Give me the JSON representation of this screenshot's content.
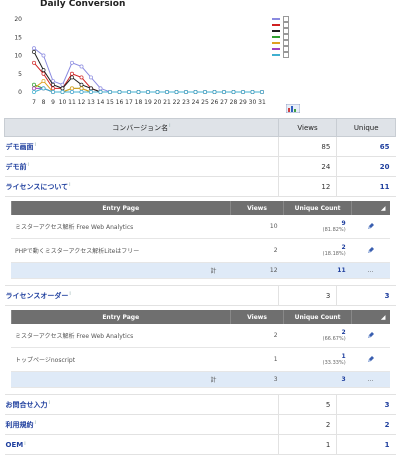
{
  "chart": {
    "title": "Daily Conversion",
    "export_icon": "chart-export-icon"
  },
  "chart_data": {
    "type": "line",
    "title": "Daily Conversion",
    "x": [
      7,
      8,
      9,
      10,
      11,
      12,
      13,
      14,
      15,
      16,
      17,
      18,
      19,
      20,
      21,
      22,
      23,
      24,
      25,
      26,
      27,
      28,
      29,
      30,
      31
    ],
    "ylim": [
      0,
      20
    ],
    "yticks": [
      0,
      5,
      10,
      15,
      20
    ],
    "grid": false,
    "legend_placement": "right",
    "series": [
      {
        "color": "#8a8ae0",
        "values": [
          12,
          10,
          3,
          2,
          8,
          7,
          4,
          1,
          0,
          0,
          0,
          0,
          0,
          0,
          0,
          0,
          0,
          0,
          0,
          0,
          0,
          0,
          0,
          0,
          0
        ]
      },
      {
        "color": "#d02020",
        "values": [
          8,
          5,
          1,
          1,
          5,
          4,
          1,
          0,
          0,
          0,
          0,
          0,
          0,
          0,
          0,
          0,
          0,
          0,
          0,
          0,
          0,
          0,
          0,
          0,
          0
        ]
      },
      {
        "color": "#202020",
        "values": [
          11,
          6,
          2,
          1,
          4,
          2,
          1,
          0,
          0,
          0,
          0,
          0,
          0,
          0,
          0,
          0,
          0,
          0,
          0,
          0,
          0,
          0,
          0,
          0,
          0
        ]
      },
      {
        "color": "#30a030",
        "values": [
          2,
          1,
          0,
          0,
          1,
          1,
          0,
          0,
          0,
          0,
          0,
          0,
          0,
          0,
          0,
          0,
          0,
          0,
          0,
          0,
          0,
          0,
          0,
          0,
          0
        ]
      },
      {
        "color": "#e0a020",
        "values": [
          1,
          3,
          0,
          0,
          1,
          1,
          0,
          0,
          0,
          0,
          0,
          0,
          0,
          0,
          0,
          0,
          0,
          0,
          0,
          0,
          0,
          0,
          0,
          0,
          0
        ]
      },
      {
        "color": "#a040c0",
        "values": [
          1,
          1,
          0,
          0,
          0,
          0,
          0,
          0,
          0,
          0,
          0,
          0,
          0,
          0,
          0,
          0,
          0,
          0,
          0,
          0,
          0,
          0,
          0,
          0,
          0
        ]
      },
      {
        "color": "#40b0d0",
        "values": [
          0,
          1,
          0,
          0,
          0,
          0,
          0,
          0,
          0,
          0,
          0,
          0,
          0,
          0,
          0,
          0,
          0,
          0,
          0,
          0,
          0,
          0,
          0,
          0,
          0
        ]
      }
    ]
  },
  "report": {
    "headers": {
      "name": "コンバージョン名",
      "views": "Views",
      "unique": "Unique"
    },
    "rows": [
      {
        "name": "デモ画面",
        "views": "85",
        "unique": "65"
      },
      {
        "name": "デモ前",
        "views": "24",
        "unique": "20"
      },
      {
        "name": "ライセンスについて",
        "views": "12",
        "unique": "11"
      },
      {
        "name": "ライセンスオーダー",
        "views": "3",
        "unique": "3"
      },
      {
        "name": "お問合せ入力",
        "views": "5",
        "unique": "3"
      },
      {
        "name": "利用規約",
        "views": "2",
        "unique": "2"
      },
      {
        "name": "OEM",
        "views": "1",
        "unique": "1"
      }
    ],
    "sub_headers": {
      "page": "Entry Page",
      "views": "Views",
      "unique": "Unique Count"
    },
    "sub1": {
      "rows": [
        {
          "page": "ミスターアクセス解析 Free Web Analytics",
          "views": "10",
          "unique": "9",
          "pct": "(81.82%)"
        },
        {
          "page": "PHPで動くミスターアクセス解析Liteはフリー",
          "views": "2",
          "unique": "2",
          "pct": "(18.18%)"
        }
      ],
      "total_label": "計",
      "total_views": "12",
      "total_unique": "11",
      "total_extra": "..."
    },
    "sub2": {
      "rows": [
        {
          "page": "ミスターアクセス解析 Free Web Analytics",
          "views": "2",
          "unique": "2",
          "pct": "(66.67%)"
        },
        {
          "page": "トップページnoscript",
          "views": "1",
          "unique": "1",
          "pct": "(33.33%)"
        }
      ],
      "total_label": "計",
      "total_views": "3",
      "total_unique": "3",
      "total_extra": "..."
    }
  }
}
